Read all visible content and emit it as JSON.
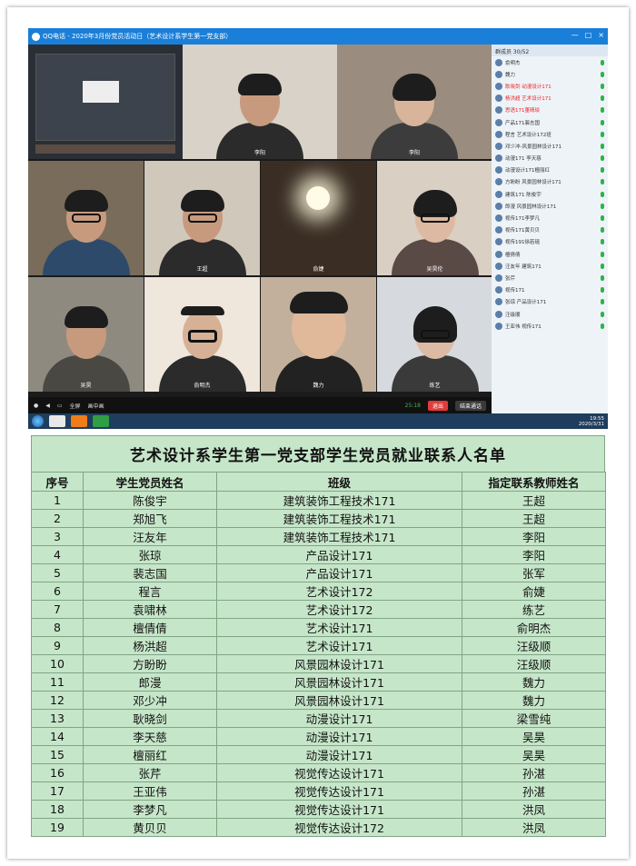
{
  "window": {
    "title": "QQ电话 - 2020年3月份党员活动日（艺术设计系学生第一党支部）",
    "controls": [
      "—",
      "□",
      "×"
    ]
  },
  "tiles": [
    {
      "name": "",
      "bg": "#2a2f36"
    },
    {
      "name": "李阳",
      "bg": "#d8d2c8"
    },
    {
      "name": "李阳",
      "bg": "#9a8c7e"
    },
    {
      "name": "",
      "bg": "#7a6c5a"
    },
    {
      "name": "王超",
      "bg": "#cfc8bb"
    },
    {
      "name": "俞婕",
      "bg": "#3a2e24"
    },
    {
      "name": "吴昊伦",
      "bg": "#d9cfc2"
    },
    {
      "name": "吴昊",
      "bg": "#8f8a80"
    },
    {
      "name": "俞明杰",
      "bg": "#efe6dc"
    },
    {
      "name": "魏力",
      "bg": "#c2b09c"
    },
    {
      "name": "练艺",
      "bg": "#d6d9de"
    }
  ],
  "sidebar": {
    "header": "群成员 30/52",
    "members": [
      {
        "label": "俞明杰",
        "red": false
      },
      {
        "label": "魏力",
        "red": false
      },
      {
        "label": "耿晓剑 动漫设计171",
        "red": true
      },
      {
        "label": "杨洪超 艺术设计171",
        "red": true
      },
      {
        "label": "思语171董晴琰",
        "red": true
      },
      {
        "label": "产品171裴志国",
        "red": false
      },
      {
        "label": "程言 艺术设计172班",
        "red": false
      },
      {
        "label": "邓少冲-风景园林设计171",
        "red": false
      },
      {
        "label": "动漫171 李天慈",
        "red": false
      },
      {
        "label": "动漫设计171檀丽红",
        "red": false
      },
      {
        "label": "方盼盼 风景园林设计171",
        "red": false
      },
      {
        "label": "建筑171 陈俊宇",
        "red": false
      },
      {
        "label": "郎漫 风景园林设计171",
        "red": false
      },
      {
        "label": "视传171李梦凡",
        "red": false
      },
      {
        "label": "视传171黄贝贝",
        "red": false
      },
      {
        "label": "视传191徐若瑶",
        "red": false
      },
      {
        "label": "檀倩倩",
        "red": false
      },
      {
        "label": "汪友年 建筑171",
        "red": false
      },
      {
        "label": "张芹",
        "red": false
      },
      {
        "label": "视传171",
        "red": false
      },
      {
        "label": "张琼 产品设计171",
        "red": false
      },
      {
        "label": "汪级顺",
        "red": false
      },
      {
        "label": "王亚伟 视传171",
        "red": false
      }
    ]
  },
  "controlbar": {
    "fullscreen": "全屏",
    "pip": "画中画",
    "signal": "25:18",
    "exit": "退出",
    "endcall": "结束通话"
  },
  "taskbar": {
    "time": "19:55",
    "date": "2020/3/31"
  },
  "table": {
    "title": "艺术设计系学生第一党支部学生党员就业联系人名单",
    "headers": [
      "序号",
      "学生党员姓名",
      "班级",
      "指定联系教师姓名"
    ],
    "rows": [
      [
        "1",
        "陈俊宇",
        "建筑装饰工程技术171",
        "王超"
      ],
      [
        "2",
        "郑旭飞",
        "建筑装饰工程技术171",
        "王超"
      ],
      [
        "3",
        "汪友年",
        "建筑装饰工程技术171",
        "李阳"
      ],
      [
        "4",
        "张琼",
        "产品设计171",
        "李阳"
      ],
      [
        "5",
        "裴志国",
        "产品设计171",
        "张军"
      ],
      [
        "6",
        "程言",
        "艺术设计172",
        "俞婕"
      ],
      [
        "7",
        "袁啸林",
        "艺术设计172",
        "练艺"
      ],
      [
        "8",
        "檀倩倩",
        "艺术设计171",
        "俞明杰"
      ],
      [
        "9",
        "杨洪超",
        "艺术设计171",
        "汪级顺"
      ],
      [
        "10",
        "方盼盼",
        "风景园林设计171",
        "汪级顺"
      ],
      [
        "11",
        "郎漫",
        "风景园林设计171",
        "魏力"
      ],
      [
        "12",
        "邓少冲",
        "风景园林设计171",
        "魏力"
      ],
      [
        "13",
        "耿晓剑",
        "动漫设计171",
        "梁雪纯"
      ],
      [
        "14",
        "李天慈",
        "动漫设计171",
        "吴昊"
      ],
      [
        "15",
        "檀丽红",
        "动漫设计171",
        "吴昊"
      ],
      [
        "16",
        "张芹",
        "视觉传达设计171",
        "孙湛"
      ],
      [
        "17",
        "王亚伟",
        "视觉传达设计171",
        "孙湛"
      ],
      [
        "18",
        "李梦凡",
        "视觉传达设计171",
        "洪凤"
      ],
      [
        "19",
        "黄贝贝",
        "视觉传达设计172",
        "洪凤"
      ]
    ]
  }
}
